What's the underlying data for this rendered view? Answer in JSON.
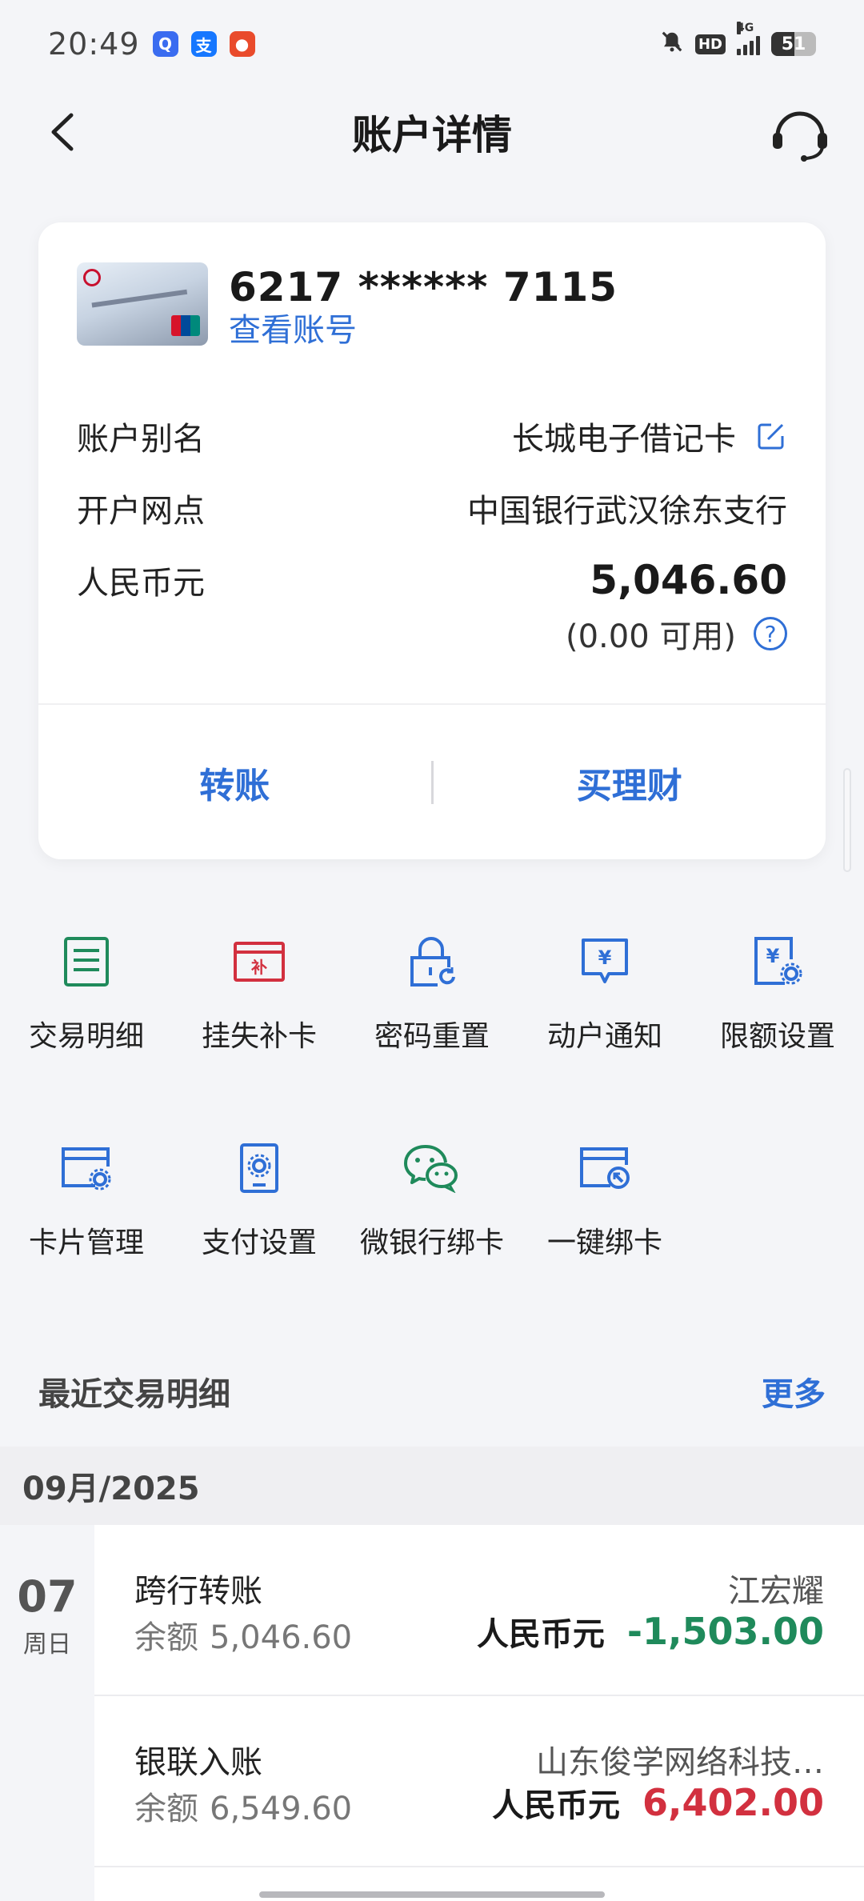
{
  "status_bar": {
    "time": "20:49",
    "apps": [
      {
        "icon": "search-app-icon",
        "color": "#3a6cf0",
        "glyph": "Q"
      },
      {
        "icon": "alipay-icon",
        "color": "#1677ff",
        "glyph": "支"
      },
      {
        "icon": "red-app-icon",
        "color": "#e94b2c",
        "glyph": "●"
      }
    ],
    "hd": "HD",
    "network": "4G",
    "battery": "51",
    "battery_level": 0.51
  },
  "header": {
    "title": "账户详情",
    "back_icon": "back-arrow-icon",
    "service_icon": "headset-icon"
  },
  "account": {
    "card_number": "6217 ****** 7115",
    "view_number_label": "查看账号",
    "alias_label": "账户别名",
    "alias_value": "长城电子借记卡",
    "branch_label": "开户网点",
    "branch_value": "中国银行武汉徐东支行",
    "currency_label": "人民币元",
    "balance": "5,046.60",
    "available": "(0.00 可用)",
    "help_glyph": "?",
    "actions": [
      "转账",
      "买理财"
    ]
  },
  "functions": [
    {
      "label": "交易明细",
      "icon": "transaction-detail-icon",
      "color": "#1f8a5b"
    },
    {
      "label": "挂失补卡",
      "icon": "report-loss-icon",
      "color": "#d2303f"
    },
    {
      "label": "密码重置",
      "icon": "password-reset-icon",
      "color": "#2f6fd6"
    },
    {
      "label": "动户通知",
      "icon": "account-notice-icon",
      "color": "#2f6fd6"
    },
    {
      "label": "限额设置",
      "icon": "limit-settings-icon",
      "color": "#2f6fd6"
    },
    {
      "label": "卡片管理",
      "icon": "card-manage-icon",
      "color": "#2f6fd6"
    },
    {
      "label": "支付设置",
      "icon": "payment-settings-icon",
      "color": "#2f6fd6"
    },
    {
      "label": "微银行绑卡",
      "icon": "wechat-bind-icon",
      "color": "#1f8a5b"
    },
    {
      "label": "一键绑卡",
      "icon": "quick-bind-icon",
      "color": "#2f6fd6"
    }
  ],
  "recent": {
    "title": "最近交易明细",
    "more": "更多",
    "month": "09月/2025",
    "day": "07",
    "weekday": "周日",
    "transactions": [
      {
        "name": "跨行转账",
        "balance_label": "余额",
        "balance": "5,046.60",
        "party": "江宏耀",
        "currency": "人民币元",
        "amount": "-1,503.00",
        "amount_color": "#1f8a5b"
      },
      {
        "name": "银联入账",
        "balance_label": "余额",
        "balance": "6,549.60",
        "party": "山东俊学网络科技…",
        "currency": "人民币元",
        "amount": "6,402.00",
        "amount_color": "#d2303f"
      }
    ]
  }
}
